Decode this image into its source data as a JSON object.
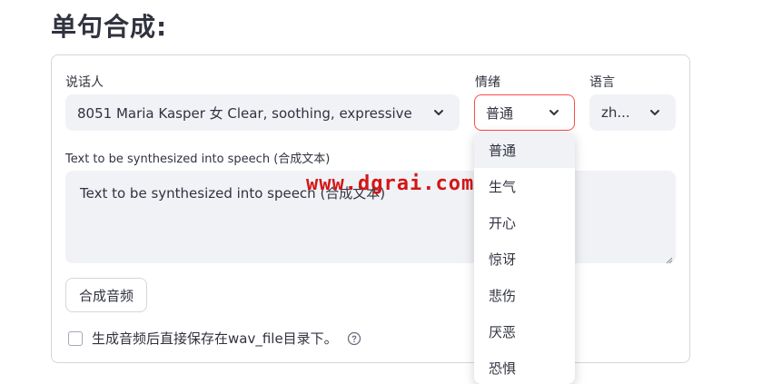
{
  "page": {
    "title": "单句合成:"
  },
  "speaker": {
    "label": "说话人",
    "value": "8051 Maria Kasper 女 Clear, soothing, expressive"
  },
  "emotion": {
    "label": "情绪",
    "value": "普通",
    "options": [
      "普通",
      "生气",
      "开心",
      "惊讶",
      "悲伤",
      "厌恶",
      "恐惧"
    ]
  },
  "language": {
    "label": "语言",
    "value": "zh..."
  },
  "text_input": {
    "label": "Text to be synthesized into speech (合成文本)",
    "value": "Text to be synthesized into speech (合成文本)"
  },
  "synth_button": {
    "label": "合成音频"
  },
  "save_checkbox": {
    "label": "生成音频后直接保存在wav_file目录下。",
    "checked": false
  },
  "watermark": {
    "text": "www.dgrai.com"
  },
  "colors": {
    "accent": "#ff4b4b",
    "field_bg": "#f0f2f6",
    "text": "#31333f",
    "watermark": "#d41616"
  }
}
